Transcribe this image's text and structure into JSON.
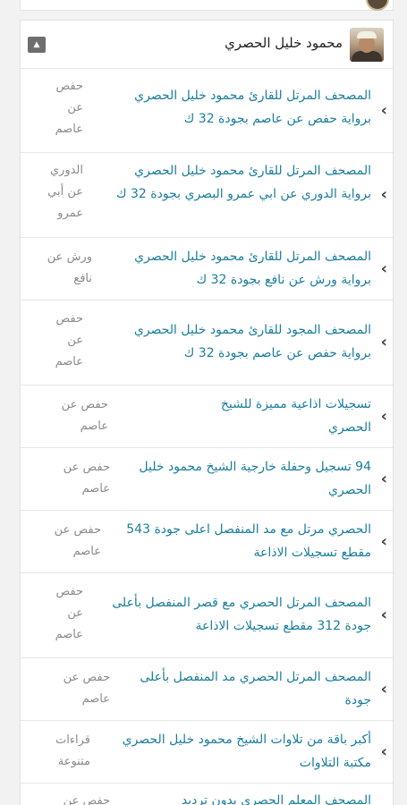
{
  "reciter": {
    "name": "محمود خليل الحصري",
    "avatar_icon": "reciter-avatar",
    "collapse_icon": "caret-up-icon"
  },
  "items": [
    {
      "title": "المصحف المرتل للقارئ محمود خليل الحصري برواية حفص عن عاصم بجودة 32 ك",
      "narration": "حفص عن عاصم"
    },
    {
      "title": "المصحف المرتل للقارئ محمود خليل الحصري برواية الدوري عن ابي عمرو البصري بجودة 32 ك",
      "narration": "الدوري عن أبي عمرو"
    },
    {
      "title": "المصحف المرتل للقارئ محمود خليل الحصري برواية ورش عن نافع بجودة 32 ك",
      "narration": "ورش عن نافع"
    },
    {
      "title": "المصحف المجود للقارئ محمود خليل الحصري برواية حفص عن عاصم بجودة 32 ك",
      "narration": "حفص عن عاصم"
    },
    {
      "title": "تسجيلات اذاعية مميزة للشيخ الحصري",
      "narration": "حفص عن عاصم"
    },
    {
      "title": "94 تسجيل وحفلة خارجية الشيخ محمود خليل الحصري",
      "narration": "حفص عن عاصم"
    },
    {
      "title": "الحصري مرتل مع مد المنفصل اعلى جودة 543 مقطع تسجيلات الاذاعة",
      "narration": "حفص عن عاصم"
    },
    {
      "title": "المصحف المرتل الحصري مع قصر المنفصل بأعلى جودة 312 مقطع تسجيلات الاذاعة",
      "narration": "حفص عن عاصم"
    },
    {
      "title": "المصحف المرتل الحصري مد المنفصل بأعلى جودة",
      "narration": "حفص عن عاصم"
    },
    {
      "title": "أكبر باقة من تلاوات الشيخ محمود خليل الحصري مكتبة التلاوات",
      "narration": "قراءات متنوعة"
    },
    {
      "title": "المصحف المعلم الحصري بدون ترديد",
      "narration": "حفص عن"
    }
  ],
  "chevron_icon": "chevron-right-icon"
}
